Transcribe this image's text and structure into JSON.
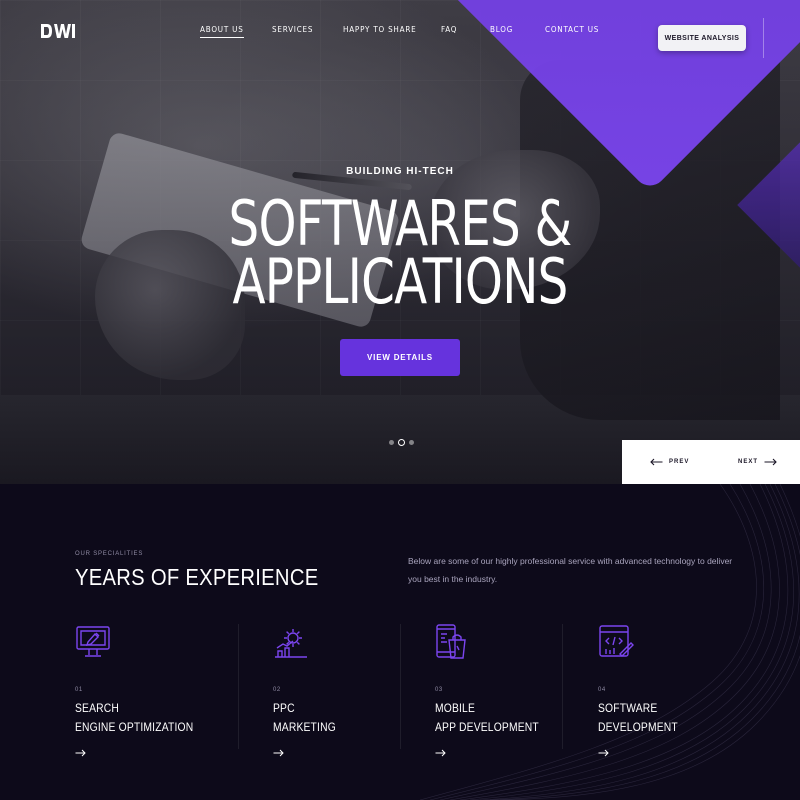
{
  "nav": {
    "logo": "DW",
    "items": [
      {
        "label": "ABOUT US",
        "active": true
      },
      {
        "label": "SERVICES",
        "active": false
      },
      {
        "label": "HAPPY TO SHARE",
        "active": false
      },
      {
        "label": "FAQ",
        "active": false
      },
      {
        "label": "BLOG",
        "active": false
      },
      {
        "label": "CONTACT US",
        "active": false
      }
    ],
    "cta_label": "WEBSITE ANALYSIS"
  },
  "hero": {
    "eyebrow": "BUILDING HI-TECH",
    "title_line1": "SOFTWARES &",
    "title_line2": "APPLICATIONS",
    "button_label": "VIEW DETAILS",
    "slides": 3,
    "active_slide": 2,
    "prev_label": "PREV",
    "next_label": "NEXT"
  },
  "specialities": {
    "eyebrow": "OUR SPECIALITIES",
    "title": "YEARS OF EXPERIENCE",
    "description": "Below are some of our highly professional service with advanced technology to deliver you best in the industry.",
    "items": [
      {
        "num": "01",
        "line1": "SEARCH",
        "line2": "ENGINE OPTIMIZATION",
        "icon": "seo-monitor-icon"
      },
      {
        "num": "02",
        "line1": "PPC",
        "line2": "MARKETING",
        "icon": "gear-growth-icon"
      },
      {
        "num": "03",
        "line1": "MOBILE",
        "line2": "APP DEVELOPMENT",
        "icon": "mobile-shop-icon"
      },
      {
        "num": "04",
        "line1": "SOFTWARE",
        "line2": "DEVELOPMENT",
        "icon": "code-window-icon"
      }
    ]
  },
  "colors": {
    "accent": "#6633dd",
    "dark_bg": "#0d0a1a",
    "icon_purple": "#7b45ef"
  }
}
